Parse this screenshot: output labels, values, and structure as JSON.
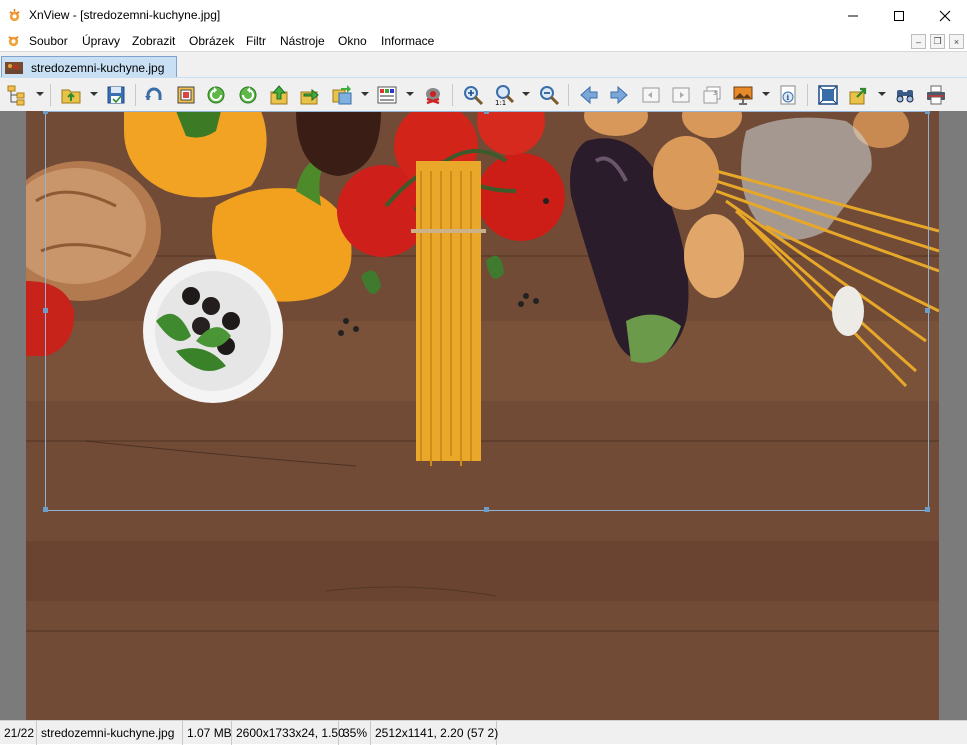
{
  "window": {
    "title": "XnView - [stredozemni-kuchyne.jpg]",
    "app_icon": "xnview-logo-icon",
    "controls": {
      "minimize_icon": "minimize-icon",
      "maximize_icon": "maximize-icon",
      "close_icon": "close-icon"
    }
  },
  "menu": {
    "items": [
      {
        "label": "Soubor"
      },
      {
        "label": "Úpravy"
      },
      {
        "label": "Zobrazit"
      },
      {
        "label": "Obrázek"
      },
      {
        "label": "Filtr"
      },
      {
        "label": "Nástroje"
      },
      {
        "label": "Okno"
      },
      {
        "label": "Informace"
      }
    ],
    "mdi": {
      "minimize": "–",
      "restore": "❐",
      "close": "×"
    }
  },
  "tabs": [
    {
      "label": "stredozemni-kuchyne.jpg",
      "icon": "image-thumbnail-icon",
      "active": true
    }
  ],
  "toolbar": {
    "icons": [
      "browser-tree-icon",
      "open-folder-icon",
      "save-icon",
      "undo-icon",
      "crop-icon",
      "rotate-left-icon",
      "rotate-right-icon",
      "move-up-icon",
      "export-icon",
      "batch-convert-icon",
      "color-adjust-icon",
      "red-eye-icon",
      "zoom-in-icon",
      "zoom-1-1-icon",
      "zoom-out-icon",
      "previous-icon",
      "next-icon",
      "first-page-icon",
      "next-page-icon",
      "multipage-icon",
      "slideshow-icon",
      "info-icon",
      "fullscreen-icon",
      "share-icon",
      "find-icon",
      "print-icon"
    ]
  },
  "image": {
    "description_color_wood": "#6f4935",
    "selection_color": "#8fb4d6"
  },
  "status": {
    "index": "21/22",
    "filename": "stredozemni-kuchyne.jpg",
    "filesize": "1.07 MB",
    "dimensions": "2600x1733x24, 1.50",
    "zoom": "35%",
    "selection": "2512x1141, 2.20 (57 2)"
  }
}
